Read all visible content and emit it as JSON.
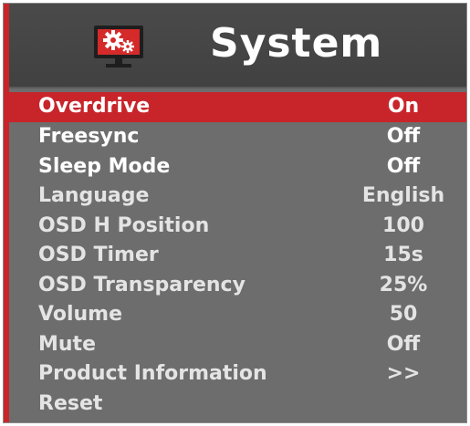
{
  "header": {
    "title": "System",
    "icon": "monitor-gears-icon"
  },
  "colors": {
    "accent": "#c8252b",
    "panel": "#6d6d6d",
    "header": "#454545"
  },
  "menu": {
    "items": [
      {
        "label": "Overdrive",
        "value": "On"
      },
      {
        "label": "Freesync",
        "value": "Off"
      },
      {
        "label": "Sleep Mode",
        "value": "Off"
      },
      {
        "label": "Language",
        "value": "English"
      },
      {
        "label": "OSD H Position",
        "value": "100"
      },
      {
        "label": "OSD Timer",
        "value": "15s"
      },
      {
        "label": "OSD Transparency",
        "value": "25%"
      },
      {
        "label": "Volume",
        "value": "50"
      },
      {
        "label": "Mute",
        "value": "Off"
      },
      {
        "label": "Product Information",
        "value": ">>"
      },
      {
        "label": "Reset",
        "value": ""
      }
    ]
  }
}
